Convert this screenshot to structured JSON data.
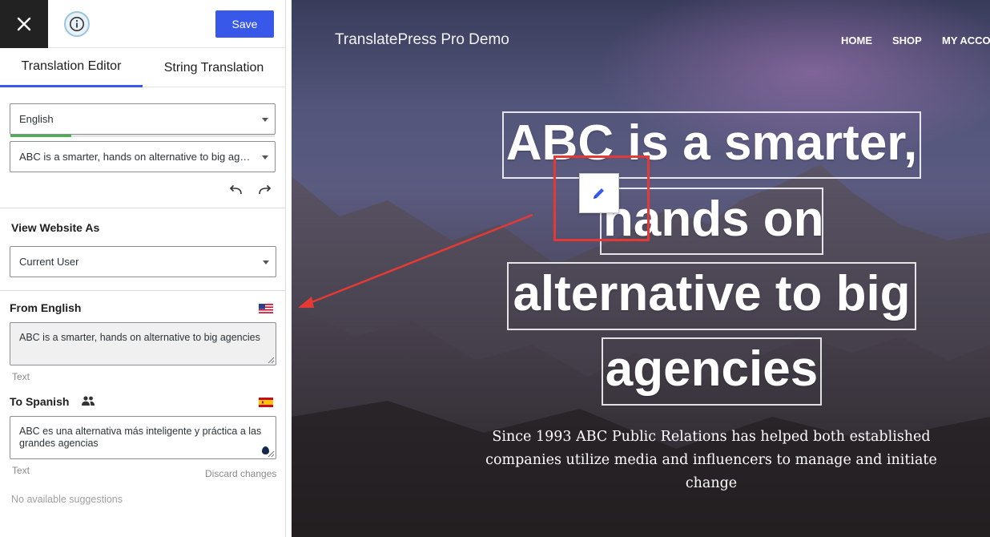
{
  "sidebar": {
    "save_label": "Save",
    "tabs": [
      {
        "label": "Translation Editor",
        "active": true
      },
      {
        "label": "String Translation",
        "active": false
      }
    ],
    "language_select": {
      "value": "English"
    },
    "string_select": {
      "value": "ABC is a smarter, hands on alternative to big agencies"
    },
    "translation_progress": 0.23,
    "view_as": {
      "label": "View Website As",
      "value": "Current User"
    },
    "from": {
      "label": "From English",
      "text": "ABC is a smarter, hands on alternative to big agencies",
      "type": "Text",
      "flag": "us-flag"
    },
    "to": {
      "label": "To Spanish",
      "text": "ABC es una alternativa más inteligente y práctica a las grandes agencias",
      "type": "Text",
      "flag": "spain-flag",
      "discard_label": "Discard changes"
    },
    "suggestions": "No available suggestions"
  },
  "preview": {
    "site_title": "TranslatePress Pro Demo",
    "nav": [
      "HOME",
      "SHOP",
      "MY ACCOU"
    ],
    "headline_lines": [
      "ABC is a smarter,",
      "hands on",
      "alternative to big",
      "agencies"
    ],
    "subtitle": "Since 1993 ABC Public Relations has helped both established companies utilize media and influencers to manage and initiate change"
  },
  "colors": {
    "accent": "#3858e9",
    "progress": "#4caf50",
    "annotation": "#e53935",
    "close_bg": "#222222"
  },
  "icons": [
    "close-icon",
    "info-icon",
    "undo-icon",
    "redo-icon",
    "us-flag-icon",
    "spain-flag-icon",
    "users-icon",
    "pencil-icon"
  ]
}
